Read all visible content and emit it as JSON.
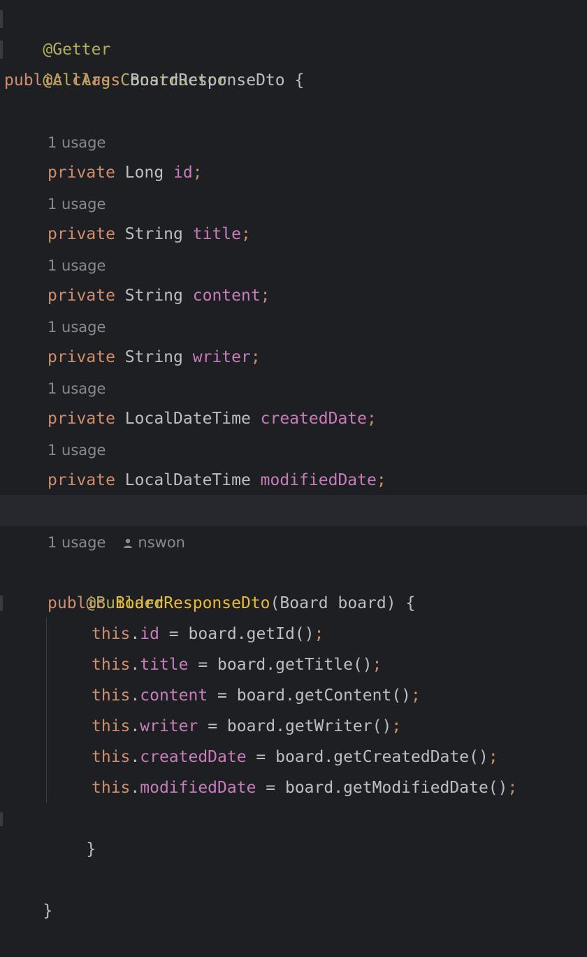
{
  "code": {
    "annotations": {
      "getter": "@Getter",
      "all_args": "@AllArgsConstructor",
      "builder": "@Builder"
    },
    "keywords": {
      "public": "public",
      "class": "class",
      "private": "private",
      "this": "this"
    },
    "class_name": "BoardResponseDto",
    "open_brace": "{",
    "close_brace": "}",
    "usage_hint": "1 usage",
    "author": "nswon",
    "fields": [
      {
        "type": "Long",
        "name": "id"
      },
      {
        "type": "String",
        "name": "title"
      },
      {
        "type": "String",
        "name": "content"
      },
      {
        "type": "String",
        "name": "writer"
      },
      {
        "type": "LocalDateTime",
        "name": "createdDate"
      },
      {
        "type": "LocalDateTime",
        "name": "modifiedDate"
      }
    ],
    "constructor": {
      "name": "BoardResponseDto",
      "param_type": "Board",
      "param_name": "board",
      "assignments": [
        {
          "field": "id",
          "getter": "getId"
        },
        {
          "field": "title",
          "getter": "getTitle"
        },
        {
          "field": "content",
          "getter": "getContent"
        },
        {
          "field": "writer",
          "getter": "getWriter"
        },
        {
          "field": "createdDate",
          "getter": "getCreatedDate"
        },
        {
          "field": "modifiedDate",
          "getter": "getModifiedDate"
        }
      ]
    }
  },
  "colors": {
    "background": "#1e1f22",
    "keyword": "#cf8e6d",
    "annotation": "#b3ae60",
    "field": "#c77dbb",
    "method": "#e8ba36",
    "text": "#bcbec4",
    "hint": "#868a91",
    "current_line": "#26282e"
  }
}
